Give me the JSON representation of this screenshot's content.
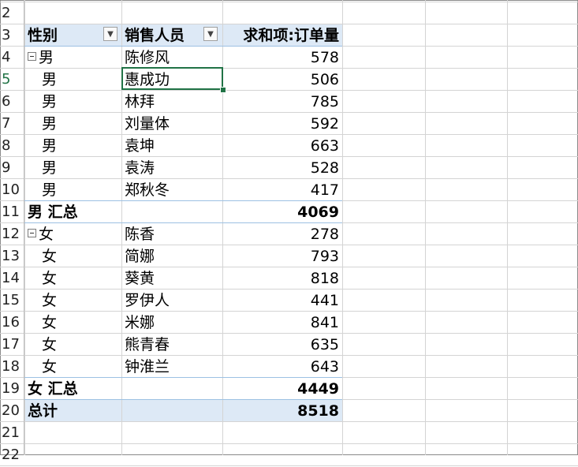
{
  "sheet": {
    "row_numbers": [
      "2",
      "3",
      "4",
      "5",
      "6",
      "7",
      "8",
      "9",
      "10",
      "11",
      "12",
      "13",
      "14",
      "15",
      "16",
      "17",
      "18",
      "19",
      "20",
      "21",
      "22"
    ],
    "header": {
      "col1": "性别",
      "col2": "销售人员",
      "col3": "求和项:订单量"
    },
    "male_group": {
      "label": "男",
      "rows": [
        {
          "gender": "男",
          "person": "陈修风",
          "value": "578"
        },
        {
          "gender": "男",
          "person": "惠成功",
          "value": "506"
        },
        {
          "gender": "男",
          "person": "林拜",
          "value": "785"
        },
        {
          "gender": "男",
          "person": "刘量体",
          "value": "592"
        },
        {
          "gender": "男",
          "person": "袁坤",
          "value": "663"
        },
        {
          "gender": "男",
          "person": "袁涛",
          "value": "528"
        },
        {
          "gender": "男",
          "person": "郑秋冬",
          "value": "417"
        }
      ],
      "subtotal_label": "男 汇总",
      "subtotal_value": "4069"
    },
    "female_group": {
      "label": "女",
      "rows": [
        {
          "gender": "女",
          "person": "陈香",
          "value": "278"
        },
        {
          "gender": "女",
          "person": "简娜",
          "value": "793"
        },
        {
          "gender": "女",
          "person": "葵黄",
          "value": "818"
        },
        {
          "gender": "女",
          "person": "罗伊人",
          "value": "441"
        },
        {
          "gender": "女",
          "person": "米娜",
          "value": "841"
        },
        {
          "gender": "女",
          "person": "熊青春",
          "value": "635"
        },
        {
          "gender": "女",
          "person": "钟淮兰",
          "value": "643"
        }
      ],
      "subtotal_label": "女 汇总",
      "subtotal_value": "4449"
    },
    "grand_total": {
      "label": "总计",
      "value": "8518"
    },
    "selected_row_number": "5",
    "accent_color": "#217346",
    "header_fill_color": "#dde9f6"
  }
}
